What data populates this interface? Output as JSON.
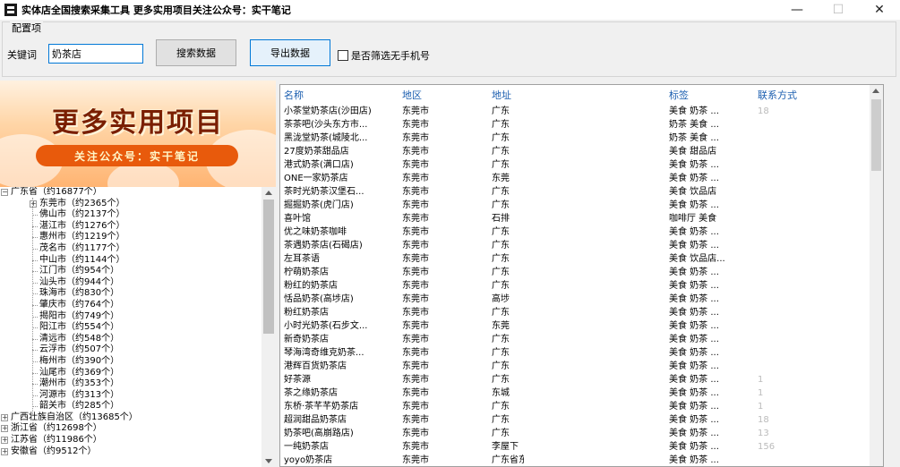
{
  "window": {
    "title": "实体店全国搜索采集工具 更多实用项目关注公众号：实干笔记",
    "minimize": "—",
    "maximize": "☐",
    "close": "✕"
  },
  "config": {
    "group_title": "配置项",
    "keyword_label": "关键词",
    "keyword_value": "奶茶店",
    "search_button": "搜索数据",
    "export_button": "导出数据",
    "filter_checkbox_label": "是否筛选无手机号",
    "filter_checked": false
  },
  "banner": {
    "main": "更多实用项目",
    "sub": "关注公众号：实干笔记"
  },
  "tree": {
    "nodes": [
      {
        "label": "广东省（约16877个）",
        "level": 0,
        "expander": "−"
      },
      {
        "label": "东莞市（约2365个）",
        "level": 1,
        "expander": "+"
      },
      {
        "label": "佛山市（约2137个）",
        "level": 1
      },
      {
        "label": "湛江市（约1276个）",
        "level": 1
      },
      {
        "label": "惠州市（约1219个）",
        "level": 1
      },
      {
        "label": "茂名市（约1177个）",
        "level": 1
      },
      {
        "label": "中山市（约1144个）",
        "level": 1
      },
      {
        "label": "江门市（约954个）",
        "level": 1
      },
      {
        "label": "汕头市（约944个）",
        "level": 1
      },
      {
        "label": "珠海市（约830个）",
        "level": 1
      },
      {
        "label": "肇庆市（约764个）",
        "level": 1
      },
      {
        "label": "揭阳市（约749个）",
        "level": 1
      },
      {
        "label": "阳江市（约554个）",
        "level": 1
      },
      {
        "label": "清远市（约548个）",
        "level": 1
      },
      {
        "label": "云浮市（约507个）",
        "level": 1
      },
      {
        "label": "梅州市（约390个）",
        "level": 1
      },
      {
        "label": "汕尾市（约369个）",
        "level": 1
      },
      {
        "label": "潮州市（约353个）",
        "level": 1
      },
      {
        "label": "河源市（约313个）",
        "level": 1
      },
      {
        "label": "韶关市（约285个）",
        "level": 1
      },
      {
        "label": "广西壮族自治区（约13685个）",
        "level": 0,
        "expander": "+"
      },
      {
        "label": "浙江省（约12698个）",
        "level": 0,
        "expander": "+"
      },
      {
        "label": "江苏省（约11986个）",
        "level": 0,
        "expander": "+"
      },
      {
        "label": "安徽省（约9512个）",
        "level": 0,
        "expander": "+"
      }
    ]
  },
  "grid": {
    "columns": [
      "名称",
      "地区",
      "地址",
      "标签",
      "联系方式"
    ],
    "rows": [
      [
        "小茶堂奶茶店(沙田店)",
        "东莞市",
        "广东",
        "美食 奶茶 ...",
        "18"
      ],
      [
        "茶茶吧(沙头东方市...",
        "东莞市",
        "广东",
        "奶茶 美食 ...",
        ""
      ],
      [
        "黑泷堂奶茶(城陵北...",
        "东莞市",
        "广东",
        "奶茶 美食 ...",
        ""
      ],
      [
        "27度奶茶甜品店",
        "东莞市",
        "广东",
        "美食 甜品店",
        ""
      ],
      [
        "港式奶茶(满口店)",
        "东莞市",
        "广东",
        "美食 奶茶 ...",
        ""
      ],
      [
        "ONE一家奶茶店",
        "东莞市",
        "东莞",
        "美食 奶茶 ...",
        ""
      ],
      [
        "茶时光奶茶汉堡石...",
        "东莞市",
        "广东",
        "美食 饮品店",
        ""
      ],
      [
        "掘掘奶茶(虎门店)",
        "东莞市",
        "广东",
        "美食 奶茶 ...",
        ""
      ],
      [
        "喜叶馆",
        "东莞市",
        "石排",
        "咖啡厅 美食",
        ""
      ],
      [
        "优之味奶茶咖啡",
        "东莞市",
        "广东",
        "美食 奶茶 ...",
        ""
      ],
      [
        "茶遇奶茶店(石碣店)",
        "东莞市",
        "广东",
        "美食 奶茶 ...",
        ""
      ],
      [
        "左耳茶语",
        "东莞市",
        "广东",
        "美食 饮品店...",
        ""
      ],
      [
        "柠萌奶茶店",
        "东莞市",
        "广东",
        "美食 奶茶 ...",
        ""
      ],
      [
        "粉红的奶茶店",
        "东莞市",
        "广东",
        "美食 奶茶 ...",
        ""
      ],
      [
        "恬品奶茶(高埗店)",
        "东莞市",
        "高埗",
        "美食 奶茶 ...",
        ""
      ],
      [
        "粉红奶茶店",
        "东莞市",
        "广东",
        "美食 奶茶 ...",
        ""
      ],
      [
        "小时光奶茶(石步文...",
        "东莞市",
        "东莞",
        "美食 奶茶 ...",
        ""
      ],
      [
        "新奇奶茶店",
        "东莞市",
        "广东",
        "美食 奶茶 ...",
        ""
      ],
      [
        "琴海湾奇维克奶茶...",
        "东莞市",
        "广东",
        "美食 奶茶 ...",
        ""
      ],
      [
        "港辉百货奶茶店",
        "东莞市",
        "广东",
        "美食 奶茶 ...",
        ""
      ],
      [
        "好茶源",
        "东莞市",
        "广东",
        "美食 奶茶 ...",
        "1"
      ],
      [
        "茶之缘奶茶店",
        "东莞市",
        "东城",
        "美食 奶茶 ...",
        "1"
      ],
      [
        "东桥·茶芊芊奶茶店",
        "东莞市",
        "广东",
        "美食 奶茶 ...",
        "1"
      ],
      [
        "超润甜品奶茶店",
        "东莞市",
        "广东",
        "美食 奶茶 ...",
        "18"
      ],
      [
        "奶茶吧(高崩路店)",
        "东莞市",
        "广东",
        "美食 奶茶 ...",
        "13"
      ],
      [
        "一纯奶茶店",
        "东莞市",
        "李屋下",
        "美食 奶茶 ...",
        "156"
      ],
      [
        "yoyo奶茶店",
        "东莞市",
        "广东省东",
        "美食 奶茶 ...",
        ""
      ]
    ]
  }
}
